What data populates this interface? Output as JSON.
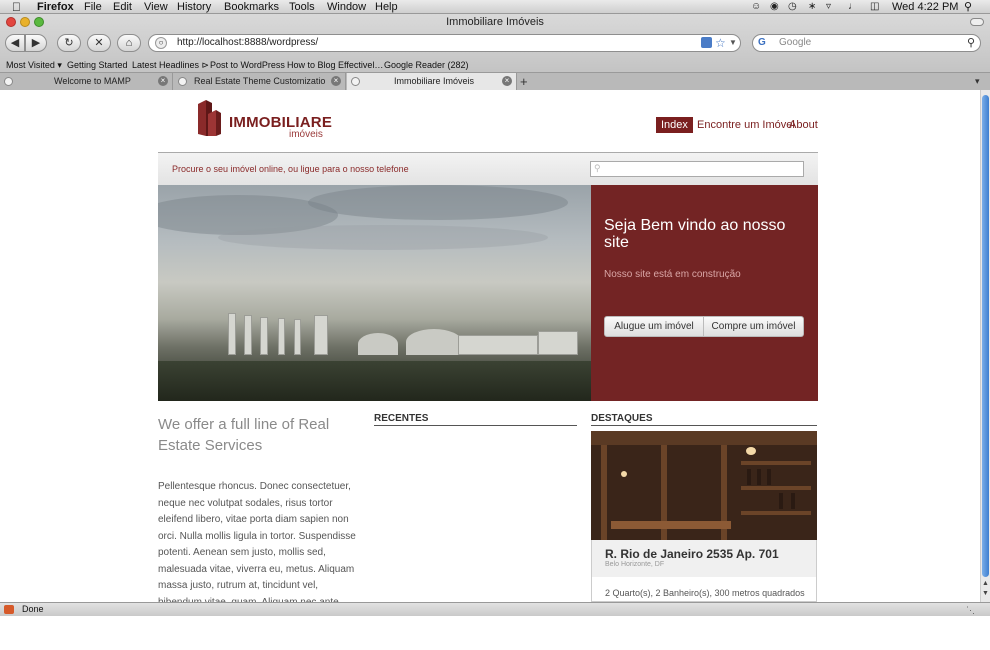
{
  "os_menubar": {
    "app_name": "Firefox",
    "menus": [
      "File",
      "Edit",
      "View",
      "History",
      "Bookmarks",
      "Tools",
      "Window",
      "Help"
    ],
    "clock": "Wed 4:22 PM"
  },
  "window": {
    "title": "Immobiliare Imóveis",
    "url": "http://localhost:8888/wordpress/",
    "search_placeholder": "Google",
    "search_engine_letter": "G"
  },
  "bookmarks": [
    "Most Visited ▾",
    "Getting Started",
    "Latest Headlines ⊳",
    "Post to WordPress",
    "How to Blog Effectivel…",
    "Google Reader (282)"
  ],
  "tabs": [
    {
      "label": "Welcome to MAMP",
      "active": false
    },
    {
      "label": "Real Estate Theme Customization…",
      "active": false
    },
    {
      "label": "Immobiliare Imóveis",
      "active": true
    }
  ],
  "site": {
    "logo_title": "IMMOBILIARE",
    "logo_sub": "imóveis",
    "nav": [
      "Index",
      "Encontre um Imóvel",
      "About"
    ],
    "tagline": "Procure o seu imóvel online, ou ligue para o nosso telefone",
    "welcome": {
      "heading": "Seja Bem vindo ao nosso site",
      "sub": "Nosso site está em construção",
      "btn_rent": "Alugue um imóvel",
      "btn_buy": "Compre um imóvel"
    },
    "col1": {
      "title": "We offer a full line of Real Estate Services",
      "body": "Pellentesque rhoncus. Donec consectetuer, neque nec volutpat sodales, risus tortor eleifend libero, vitae porta diam sapien non orci. Nulla mollis ligula in tortor. Suspendisse potenti. Aenean sem justo, mollis sed, malesuada vitae, viverra eu, metus. Aliquam massa justo, rutrum at, tincidunt vel, bibendum vitae, quam. Aliquam nec ante."
    },
    "recentes_heading": "RECENTES",
    "destaques_heading": "DESTAQUES",
    "featured": {
      "title": "R. Rio de Janeiro 2535 Ap. 701",
      "location": "Belo Horizonte, DF",
      "details": "2 Quarto(s), 2 Banheiro(s), 300 metros quadrados"
    }
  },
  "status": "Done",
  "colors": {
    "brand": "#7a1f1f",
    "welcome_bg": "#732424"
  }
}
